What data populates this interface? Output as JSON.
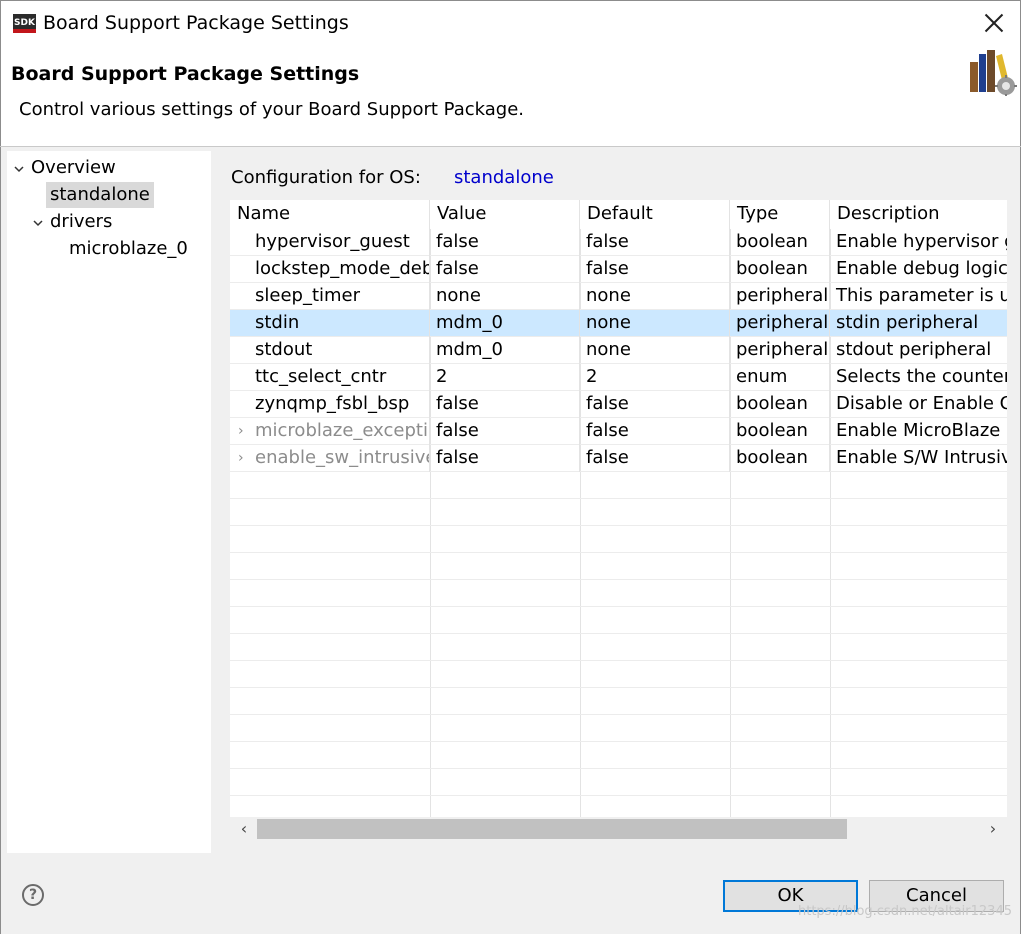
{
  "window": {
    "title": "Board Support Package Settings",
    "app_icon_label": "SDK"
  },
  "header": {
    "title": "Board Support Package Settings",
    "description": "Control various settings of your Board Support Package."
  },
  "tree": {
    "overview": "Overview",
    "standalone": "standalone",
    "drivers": "drivers",
    "microblaze": "microblaze_0"
  },
  "config": {
    "label": "Configuration for OS:",
    "os": "standalone"
  },
  "table": {
    "headers": [
      "Name",
      "Value",
      "Default",
      "Type",
      "Description"
    ],
    "rows": [
      {
        "name": "hypervisor_guest",
        "value": "false",
        "default": "false",
        "type": "boolean",
        "description": "Enable hypervisor g"
      },
      {
        "name": "lockstep_mode_debu",
        "value": "false",
        "default": "false",
        "type": "boolean",
        "description": "Enable debug logic"
      },
      {
        "name": "sleep_timer",
        "value": "none",
        "default": "none",
        "type": "peripheral",
        "description": "This parameter is us"
      },
      {
        "name": "stdin",
        "value": "mdm_0",
        "default": "none",
        "type": "peripheral",
        "description": "stdin peripheral"
      },
      {
        "name": "stdout",
        "value": "mdm_0",
        "default": "none",
        "type": "peripheral",
        "description": "stdout peripheral"
      },
      {
        "name": "ttc_select_cntr",
        "value": "2",
        "default": "2",
        "type": "enum",
        "description": "Selects the counter"
      },
      {
        "name": "zynqmp_fsbl_bsp",
        "value": "false",
        "default": "false",
        "type": "boolean",
        "description": "Disable or Enable O"
      },
      {
        "name": "microblaze_exceptio",
        "value": "false",
        "default": "false",
        "type": "boolean",
        "description": "Enable MicroBlaze E"
      },
      {
        "name": "enable_sw_intrusive_",
        "value": "false",
        "default": "false",
        "type": "boolean",
        "description": "Enable S/W Intrusive"
      }
    ]
  },
  "buttons": {
    "ok": "OK",
    "cancel": "Cancel",
    "help": "?"
  },
  "watermark": "https://blog.csdn.net/altair12345",
  "colors": {
    "selection": "#cce8ff",
    "link": "#0000cc",
    "ok_border": "#0078d7"
  }
}
